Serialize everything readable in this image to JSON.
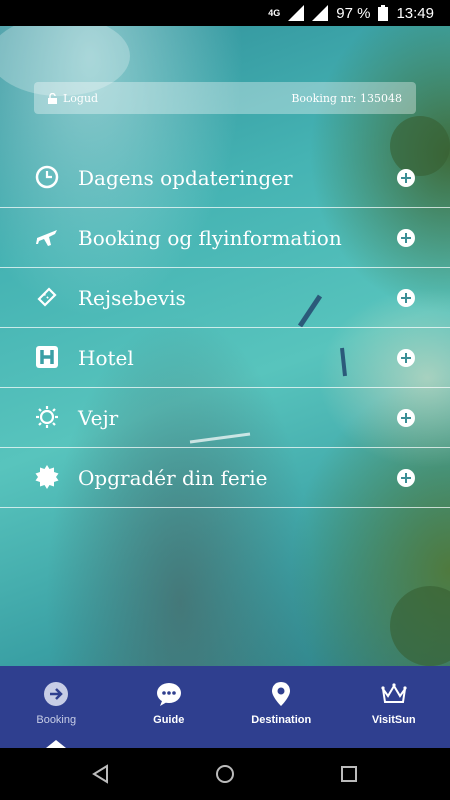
{
  "status": {
    "network": "4G",
    "battery": "97 %",
    "time": "13:49"
  },
  "login": {
    "logout_label": "Logud",
    "booking_label": "Booking nr: 135048"
  },
  "menu": [
    {
      "label": "Dagens opdateringer",
      "icon": "clock-icon"
    },
    {
      "label": "Booking og flyinformation",
      "icon": "airplane-icon"
    },
    {
      "label": "Rejsebevis",
      "icon": "ticket-icon"
    },
    {
      "label": "Hotel",
      "icon": "hotel-icon"
    },
    {
      "label": "Vejr",
      "icon": "sun-icon"
    },
    {
      "label": "Opgradér din ferie",
      "icon": "badge-icon"
    }
  ],
  "tabs": [
    {
      "label": "Booking",
      "icon": "arrow-circle-icon",
      "active": true
    },
    {
      "label": "Guide",
      "icon": "chat-bubble-icon",
      "active": false
    },
    {
      "label": "Destination",
      "icon": "location-pin-icon",
      "active": false
    },
    {
      "label": "VisitSun",
      "icon": "crown-icon",
      "active": false
    }
  ],
  "colors": {
    "tabbar": "#2f3f8f",
    "active_tab_label": "#c7cde6"
  }
}
